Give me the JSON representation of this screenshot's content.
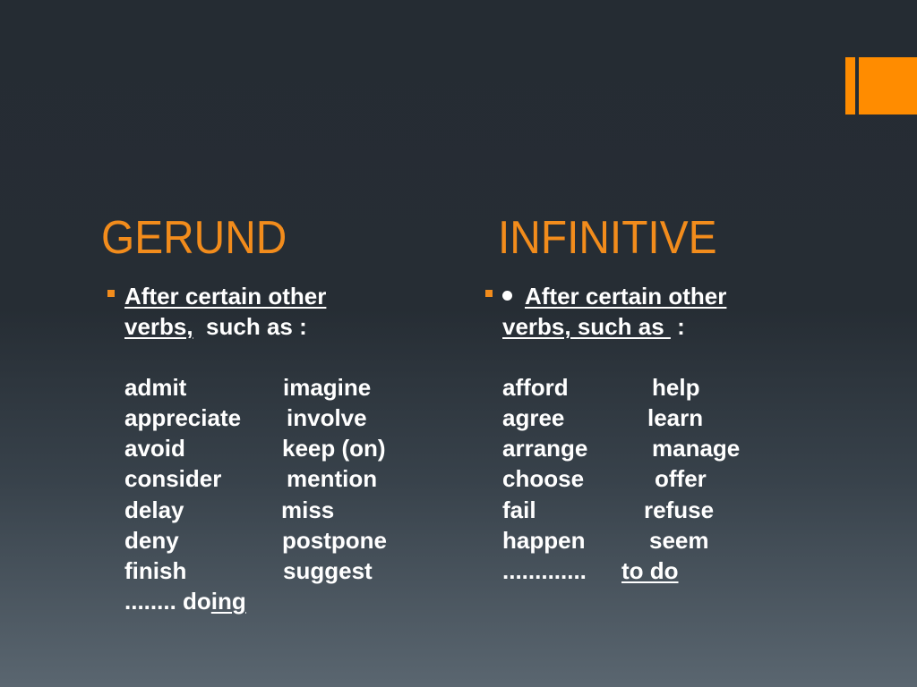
{
  "slide": {
    "accent_color": "#ff8c00",
    "title_color": "#f28c1c"
  },
  "gerund": {
    "title": "GERUND",
    "intro_line1": "After certain other",
    "intro_line2_underlined": "verbs,",
    "intro_line2_rest": "  such as :",
    "col1": [
      "admit",
      "appreciate",
      "avoid",
      "consider",
      "delay",
      "deny",
      "finish"
    ],
    "col2": [
      "imagine",
      "involve",
      "keep (on)",
      "mention",
      "miss",
      "postpone",
      "suggest"
    ],
    "footer_dots": "........",
    "footer_plain": "do",
    "footer_underlined": "ing"
  },
  "infinitive": {
    "title": "INFINITIVE",
    "intro_line1": "After certain other",
    "intro_line2_underlined": "verbs, such as ",
    "intro_line2_rest": " :",
    "col1": [
      "afford",
      "agree",
      "arrange",
      "choose",
      "fail",
      "happen"
    ],
    "col2": [
      "help",
      "learn",
      "manage",
      "offer",
      "refuse",
      "seem"
    ],
    "footer_dots": ".............",
    "footer_underlined": "to do"
  }
}
